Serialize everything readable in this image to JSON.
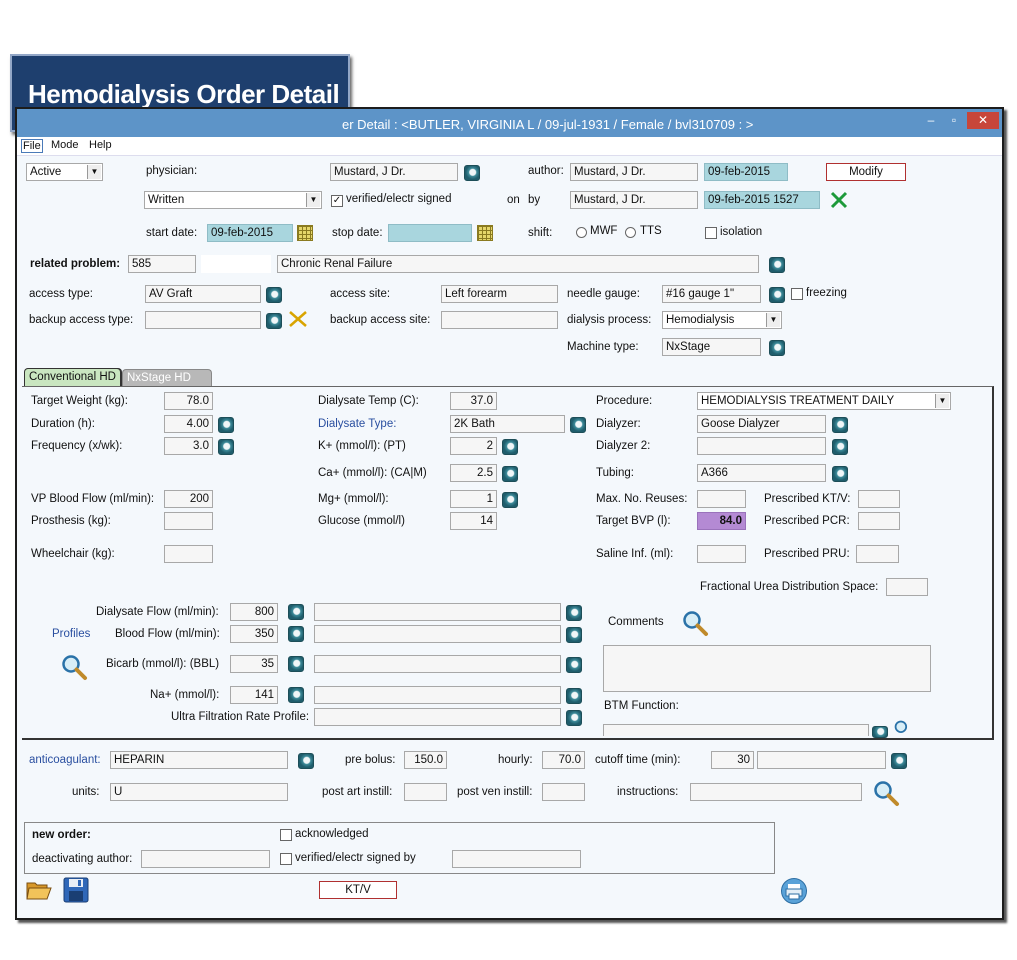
{
  "badge_title": "Hemodialysis Order Detail",
  "window": {
    "title": "er Detail :  <BUTLER, VIRGINIA L / 09-jul-1931 / Female / bvl310709 : >",
    "min": "–",
    "max": "▫",
    "close": "✕"
  },
  "menu": {
    "file": "File",
    "mode": "Mode",
    "help": "Help"
  },
  "header": {
    "status": "Active",
    "physician_label": "physician:",
    "physician": "Mustard, J Dr.",
    "author_label": "author:",
    "author": "Mustard, J Dr.",
    "author_date": "09-feb-2015",
    "modify": "Modify",
    "order_type": "Written",
    "verified_label": "verified/electr signed",
    "verified_check": "✓",
    "on_label": "on",
    "by_label": "by",
    "signed_by": "Mustard, J Dr.",
    "signed_date": "09-feb-2015 1527",
    "start_label": "start date:",
    "start_date": "09-feb-2015",
    "stop_label": "stop date:",
    "stop_date": "",
    "shift_label": "shift:",
    "mwf": "MWF",
    "tts": "TTS",
    "isolation": "isolation"
  },
  "problem": {
    "label": "related problem:",
    "code": "585",
    "blank": "",
    "desc": "Chronic Renal Failure"
  },
  "access": {
    "type_label": "access type:",
    "type": "AV Graft",
    "site_label": "access site:",
    "site": "Left forearm",
    "needle_label": "needle gauge:",
    "needle": "#16 gauge 1\"",
    "freezing": "freezing",
    "backup_type_label": "backup access type:",
    "backup_type": "",
    "backup_site_label": "backup access site:",
    "backup_site": "",
    "process_label": "dialysis process:",
    "process": "Hemodialysis",
    "machine_label": "Machine type:",
    "machine": "NxStage"
  },
  "tabs": [
    "Conventional HD",
    "NxStage HD"
  ],
  "params": {
    "target_weight_label": "Target Weight (kg):",
    "target_weight": "78.0",
    "duration_label": "Duration (h):",
    "duration": "4.00",
    "frequency_label": "Frequency (x/wk):",
    "frequency": "3.0",
    "vp_label": "VP Blood Flow (ml/min):",
    "vp": "200",
    "prosthesis_label": "Prosthesis (kg):",
    "prosthesis": "",
    "wheelchair_label": "Wheelchair (kg):",
    "wheelchair": "",
    "temp_label": "Dialysate Temp (C):",
    "temp": "37.0",
    "dtype_label": "Dialysate Type:",
    "dtype": "2K Bath",
    "k_label": "K+ (mmol/l): (PT)",
    "k": "2",
    "ca_label": "Ca+ (mmol/l): (CA|M)",
    "ca": "2.5",
    "mg_label": "Mg+ (mmol/l):",
    "mg": "1",
    "glucose_label": "Glucose (mmol/l)",
    "glucose": "14",
    "procedure_label": "Procedure:",
    "procedure": "HEMODIALYSIS TREATMENT DAILY",
    "dialyzer_label": "Dialyzer:",
    "dialyzer": "Goose Dialyzer",
    "dialyzer2_label": "Dialyzer 2:",
    "dialyzer2": "",
    "tubing_label": "Tubing:",
    "tubing": "A366",
    "reuses_label": "Max. No. Reuses:",
    "reuses": "",
    "ktv_label": "Prescribed KT/V:",
    "ktv": "",
    "bvp_label": "Target BVP (l):",
    "bvp": "84.0",
    "pcr_label": "Prescribed PCR:",
    "pcr": "",
    "saline_label": "Saline Inf. (ml):",
    "saline": "",
    "pru_label": "Prescribed PRU:",
    "pru": "",
    "fuds_label": "Fractional Urea Distribution Space:",
    "fuds": ""
  },
  "profiles": {
    "label": "Profiles",
    "dflow_label": "Dialysate Flow (ml/min):",
    "dflow": "800",
    "bflow_label": "Blood Flow (ml/min):",
    "bflow": "350",
    "bicarb_label": "Bicarb (mmol/l): (BBL)",
    "bicarb": "35",
    "na_label": "Na+ (mmol/l):",
    "na": "141",
    "ufr_label": "Ultra Filtration Rate Profile:"
  },
  "comments": {
    "label": "Comments",
    "btm_label": "BTM Function:"
  },
  "anticoag": {
    "label": "anticoagulant:",
    "value": "HEPARIN",
    "prebolus_label": "pre bolus:",
    "prebolus": "150.0",
    "hourly_label": "hourly:",
    "hourly": "70.0",
    "cutoff_label": "cutoff time (min):",
    "cutoff": "30",
    "units_label": "units:",
    "units": "U",
    "postart_label": "post art instill:",
    "postven_label": "post ven instill:",
    "instructions_label": "instructions:"
  },
  "neworder": {
    "label": "new order:",
    "ack": "acknowledged",
    "deact_label": "deactivating author:",
    "verified": "verified/electr signed by"
  },
  "footer": {
    "ktv_button": "KT/V"
  }
}
